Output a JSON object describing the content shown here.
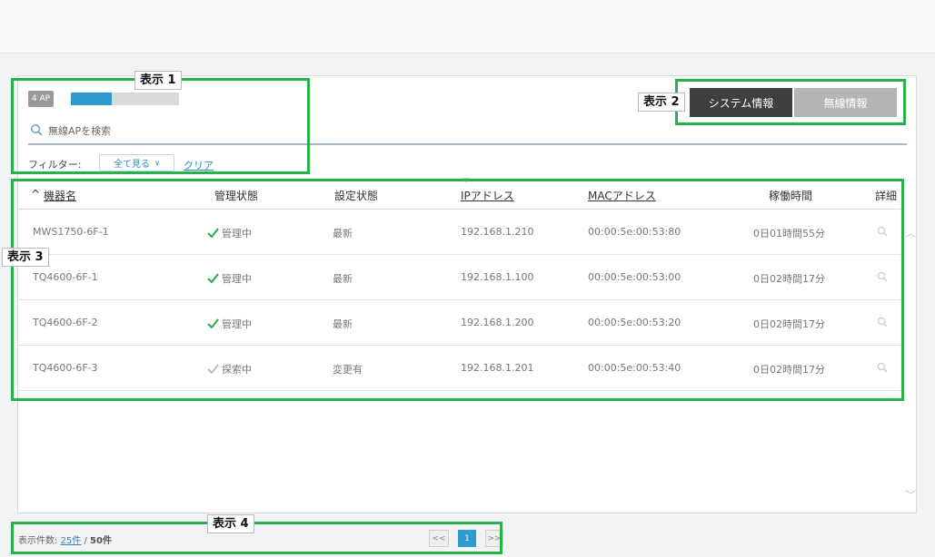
{
  "ap_count_badge": "4 AP",
  "ap_status_fill": 0.38,
  "search": {
    "placeholder": "無線APを検索"
  },
  "filter": {
    "label": "フィルター:",
    "selected": "全て見る",
    "clear": "クリア"
  },
  "tabs": [
    {
      "label": "システム情報",
      "active": true
    },
    {
      "label": "無線情報",
      "active": false
    }
  ],
  "table": {
    "sort_indicator": "^",
    "headers": [
      "機器名",
      "管理状態",
      "設定状態",
      "IPアドレス",
      "MACアドレス",
      "稼働時間",
      "詳細"
    ],
    "rows": [
      {
        "name": "MWS1750-6F-1",
        "manage": "管理中",
        "config": "最新",
        "ip": "192.168.1.210",
        "mac": "00:00:5e:00:53:80",
        "uptime": "0日01時間55分"
      },
      {
        "name": "TQ4600-6F-1",
        "manage": "管理中",
        "config": "最新",
        "ip": "192.168.1.100",
        "mac": "00:00:5e:00:53:00",
        "uptime": "0日02時間17分"
      },
      {
        "name": "TQ4600-6F-2",
        "manage": "管理中",
        "config": "最新",
        "ip": "192.168.1.200",
        "mac": "00:00:5e:00:53:20",
        "uptime": "0日02時間17分"
      },
      {
        "name": "TQ4600-6F-3",
        "manage": "探索中",
        "config": "変更有",
        "ip": "192.168.1.201",
        "mac": "00:00:5e:00:53:40",
        "uptime": "0日02時間17分"
      }
    ]
  },
  "footer": {
    "count_label": "表示件数:",
    "page_size": "25件",
    "separator": "/",
    "total": "50件"
  },
  "pagination": {
    "prev": "<<",
    "current": "1",
    "next": ">>"
  },
  "annotations": [
    "表示 1",
    "表示 2",
    "表示 3",
    "表示 4"
  ],
  "colors": {
    "accent": "#2f9bd3",
    "highlight_box": "#28b04a",
    "ok_check": "#2aa84a",
    "pending_check": "#bdbdbd",
    "active_tab": "#3f3f3f",
    "inactive_tab": "#b5b5b5"
  }
}
